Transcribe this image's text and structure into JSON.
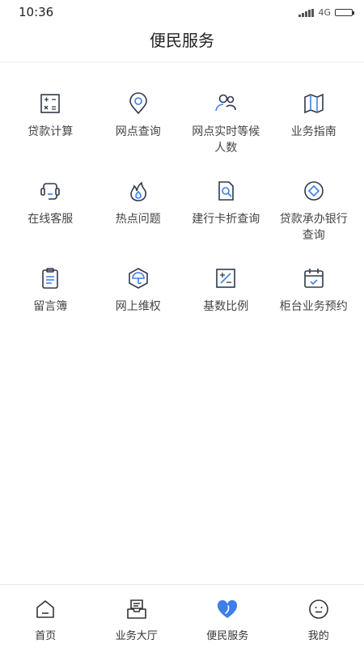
{
  "status": {
    "time": "10:36",
    "network": "4G"
  },
  "header": {
    "title": "便民服务"
  },
  "services": [
    {
      "label": "贷款计算"
    },
    {
      "label": "网点查询"
    },
    {
      "label": "网点实时等候人数"
    },
    {
      "label": "业务指南"
    },
    {
      "label": "在线客服"
    },
    {
      "label": "热点问题"
    },
    {
      "label": "建行卡折查询"
    },
    {
      "label": "贷款承办银行查询"
    },
    {
      "label": "留言簿"
    },
    {
      "label": "网上维权"
    },
    {
      "label": "基数比例"
    },
    {
      "label": "柜台业务预约"
    }
  ],
  "tabs": [
    {
      "label": "首页"
    },
    {
      "label": "业务大厅"
    },
    {
      "label": "便民服务",
      "active": true
    },
    {
      "label": "我的"
    }
  ],
  "colors": {
    "accent": "#3d7ee8",
    "icon": "#2f3a4a"
  }
}
